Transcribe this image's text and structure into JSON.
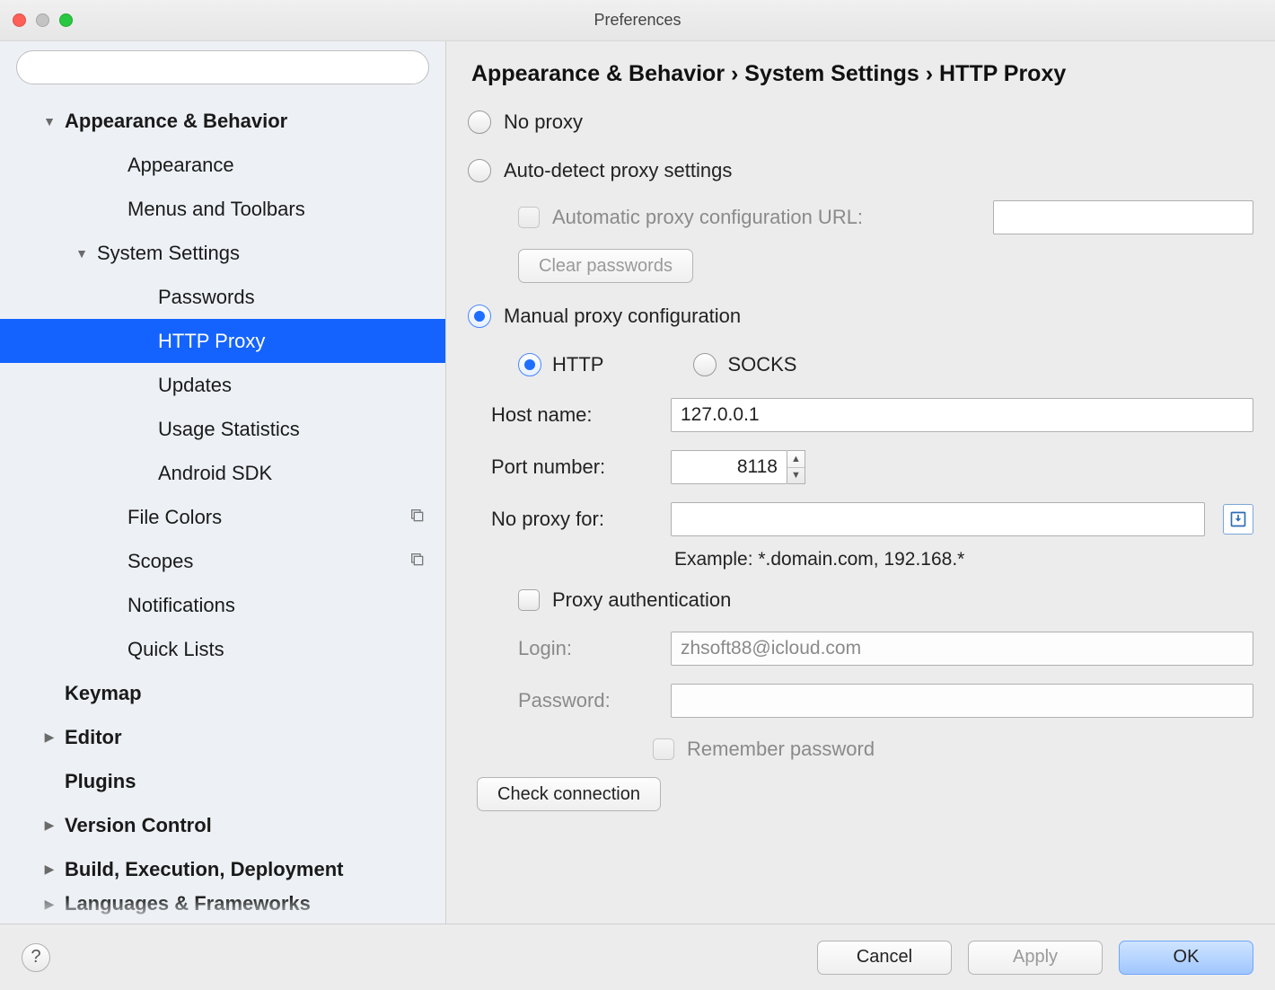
{
  "window": {
    "title": "Preferences"
  },
  "search": {
    "placeholder": ""
  },
  "tree": [
    {
      "label": "Appearance & Behavior",
      "level": 0,
      "bold": true,
      "arrow": "down",
      "name": "appearance-behavior"
    },
    {
      "label": "Appearance",
      "level": 1,
      "bold": false,
      "arrow": "",
      "name": "appearance"
    },
    {
      "label": "Menus and Toolbars",
      "level": 1,
      "bold": false,
      "arrow": "",
      "name": "menus-toolbars"
    },
    {
      "label": "System Settings",
      "level": 1,
      "bold": false,
      "arrow": "down",
      "name": "system-settings",
      "arrowIndent": true
    },
    {
      "label": "Passwords",
      "level": 2,
      "bold": false,
      "arrow": "",
      "name": "passwords"
    },
    {
      "label": "HTTP Proxy",
      "level": 2,
      "bold": false,
      "arrow": "",
      "name": "http-proxy",
      "selected": true
    },
    {
      "label": "Updates",
      "level": 2,
      "bold": false,
      "arrow": "",
      "name": "updates"
    },
    {
      "label": "Usage Statistics",
      "level": 2,
      "bold": false,
      "arrow": "",
      "name": "usage-statistics"
    },
    {
      "label": "Android SDK",
      "level": 2,
      "bold": false,
      "arrow": "",
      "name": "android-sdk"
    },
    {
      "label": "File Colors",
      "level": 1,
      "bold": false,
      "arrow": "",
      "name": "file-colors",
      "trailingIcon": true
    },
    {
      "label": "Scopes",
      "level": 1,
      "bold": false,
      "arrow": "",
      "name": "scopes",
      "trailingIcon": true
    },
    {
      "label": "Notifications",
      "level": 1,
      "bold": false,
      "arrow": "",
      "name": "notifications"
    },
    {
      "label": "Quick Lists",
      "level": 1,
      "bold": false,
      "arrow": "",
      "name": "quick-lists"
    },
    {
      "label": "Keymap",
      "level": 0,
      "bold": true,
      "arrow": "",
      "name": "keymap"
    },
    {
      "label": "Editor",
      "level": 0,
      "bold": true,
      "arrow": "right",
      "name": "editor"
    },
    {
      "label": "Plugins",
      "level": 0,
      "bold": true,
      "arrow": "",
      "name": "plugins"
    },
    {
      "label": "Version Control",
      "level": 0,
      "bold": true,
      "arrow": "right",
      "name": "version-control"
    },
    {
      "label": "Build, Execution, Deployment",
      "level": 0,
      "bold": true,
      "arrow": "right",
      "name": "build-exec-deploy"
    }
  ],
  "tree_cutoff": "Languages & Frameworks",
  "breadcrumb": {
    "a": "Appearance & Behavior",
    "sep": " › ",
    "b": "System Settings",
    "c": "HTTP Proxy"
  },
  "proxy": {
    "no_proxy": "No proxy",
    "auto_detect": "Auto-detect proxy settings",
    "auto_url_label": "Automatic proxy configuration URL:",
    "auto_url_value": "",
    "clear_passwords": "Clear passwords",
    "manual": "Manual proxy configuration",
    "http": "HTTP",
    "socks": "SOCKS",
    "host_label": "Host name:",
    "host_value": "127.0.0.1",
    "port_label": "Port number:",
    "port_value": "8118",
    "no_proxy_for_label": "No proxy for:",
    "no_proxy_for_value": "",
    "example": "Example: *.domain.com, 192.168.*",
    "auth_label": "Proxy authentication",
    "login_label": "Login:",
    "login_value": "zhsoft88@icloud.com",
    "password_label": "Password:",
    "password_value": "",
    "remember": "Remember password",
    "check": "Check connection"
  },
  "footer": {
    "help": "?",
    "cancel": "Cancel",
    "apply": "Apply",
    "ok": "OK"
  }
}
